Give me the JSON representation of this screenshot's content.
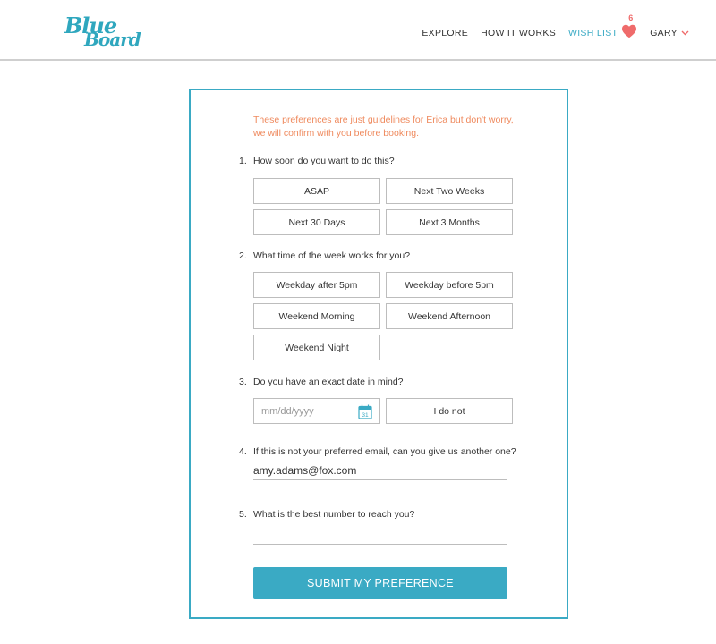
{
  "brand": {
    "logo_line1": "Blue",
    "logo_line2": "Board",
    "accent": "#3aaac4",
    "heart_color": "#ef6b6b"
  },
  "nav": {
    "items": [
      {
        "label": "EXPLORE"
      },
      {
        "label": "HOW IT WORKS"
      },
      {
        "label": "WISH LIST"
      },
      {
        "label": "GARY"
      }
    ],
    "wishlist_count": "6",
    "icons": [
      "heart-icon",
      "chevron-down-icon"
    ]
  },
  "form": {
    "intro": "These preferences are just guidelines for Erica but don't worry, we will confirm with you before booking.",
    "intro_color": "#ef8a5e",
    "q1": {
      "num": "1.",
      "text": "How soon do you want to do this?",
      "options": [
        "ASAP",
        "Next Two Weeks",
        "Next 30 Days",
        "Next 3 Months"
      ]
    },
    "q2": {
      "num": "2.",
      "text": "What time of the week works for you?",
      "options": [
        "Weekday after 5pm",
        "Weekday before 5pm",
        "Weekend Morning",
        "Weekend Afternoon",
        "Weekend Night"
      ]
    },
    "q3": {
      "num": "3.",
      "text": "Do you have an exact date in mind?",
      "date_placeholder": "mm/dd/yyyy",
      "calendar_day": "31",
      "no_date_label": "I do not"
    },
    "q4": {
      "num": "4.",
      "text": "If this is not your preferred email, can you give us another one?",
      "email_value": "amy.adams@fox.com"
    },
    "q5": {
      "num": "5.",
      "text": "What is the best number to reach you?",
      "phone_value": ""
    },
    "submit_label": "SUBMIT MY PREFERENCE"
  }
}
